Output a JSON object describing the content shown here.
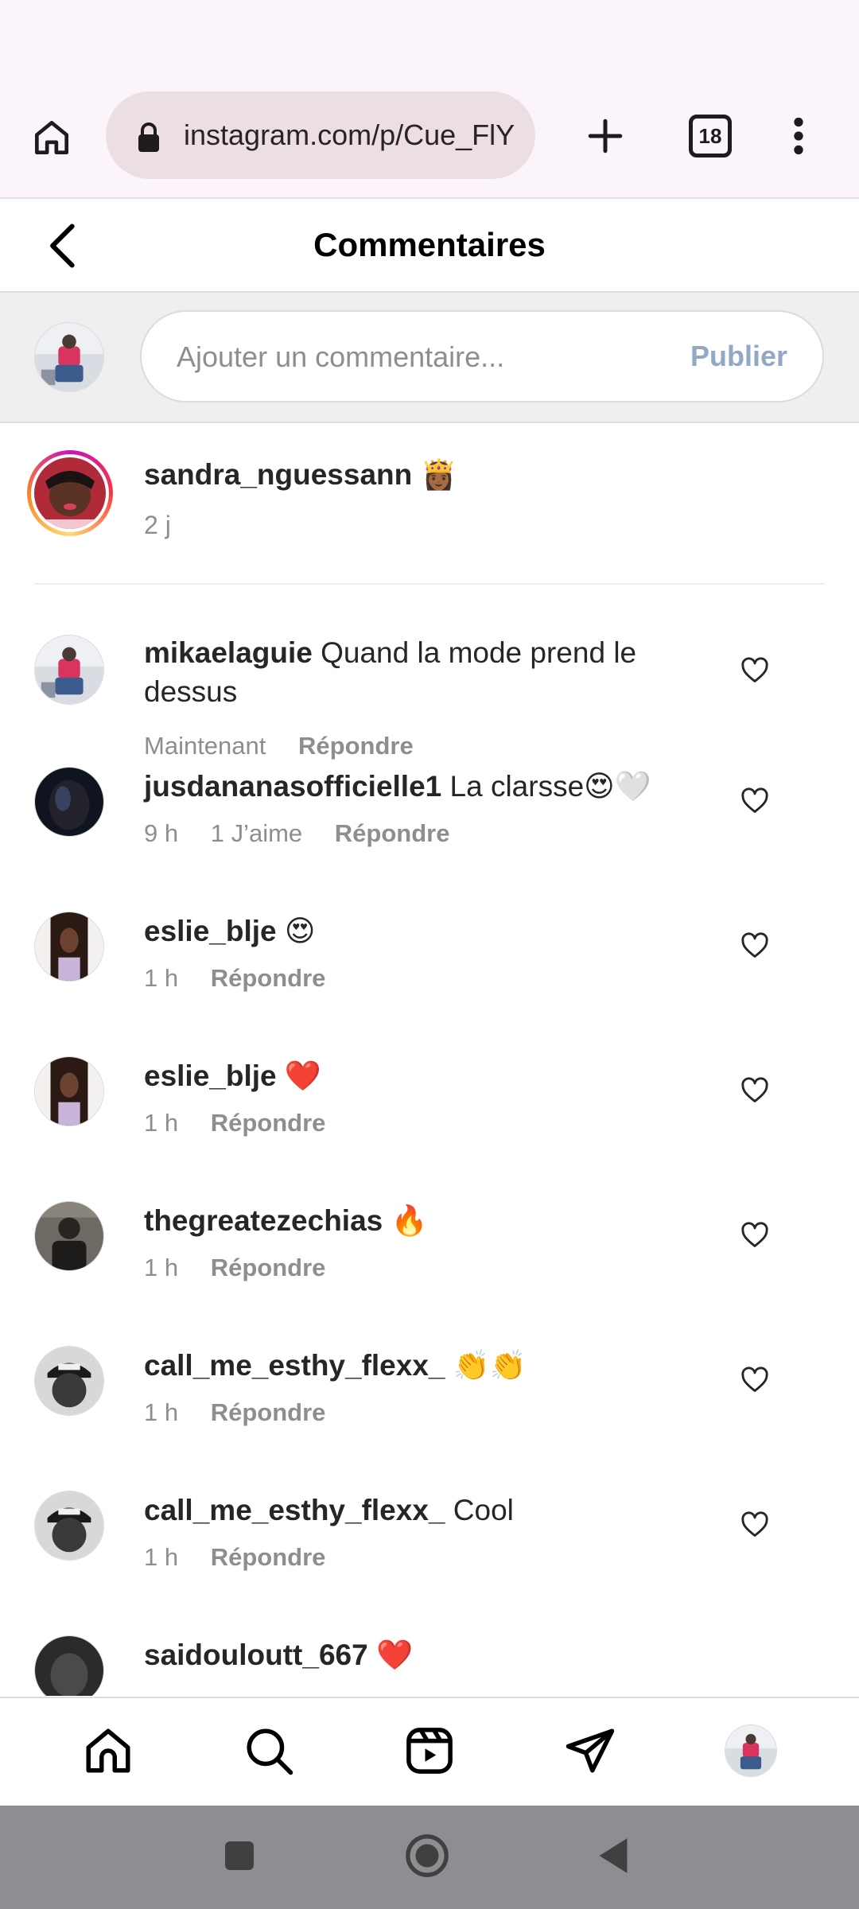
{
  "browser": {
    "url": "instagram.com/p/Cue_FlY",
    "tab_count": "18"
  },
  "header": {
    "title": "Commentaires"
  },
  "composer": {
    "placeholder": "Ajouter un commentaire...",
    "publish_label": "Publier"
  },
  "caption": {
    "username": "sandra_nguessann 👸🏾",
    "time": "2 j"
  },
  "comments": [
    {
      "username": "mikaelaguie",
      "text": "Quand la mode prend le dessus",
      "time": "Maintenant",
      "likes": "",
      "reply": "Répondre"
    },
    {
      "username": "jusdananasofficielle1",
      "text": "La clarsse😍🤍",
      "time": "9 h",
      "likes": "1 J’aime",
      "reply": "Répondre"
    },
    {
      "username": "eslie_blje",
      "text": "😍",
      "time": "1 h",
      "likes": "",
      "reply": "Répondre"
    },
    {
      "username": "eslie_blje",
      "text": "❤️",
      "time": "1 h",
      "likes": "",
      "reply": "Répondre"
    },
    {
      "username": "thegreatezechias",
      "text": "🔥",
      "time": "1 h",
      "likes": "",
      "reply": "Répondre"
    },
    {
      "username": "call_me_esthy_flexx_",
      "text": "👏👏",
      "time": "1 h",
      "likes": "",
      "reply": "Répondre"
    },
    {
      "username": "call_me_esthy_flexx_",
      "text": "Cool",
      "time": "1 h",
      "likes": "",
      "reply": "Répondre"
    },
    {
      "username": "saidouloutt_667",
      "text": "❤️",
      "time": "",
      "likes": "",
      "reply": ""
    }
  ],
  "icons": {
    "browser_home": "home-icon",
    "lock": "lock-icon",
    "new_tab": "plus-icon",
    "tabs": "tabs-icon",
    "menu": "more-vertical-icon",
    "back": "chevron-left-icon",
    "heart": "heart-outline-icon",
    "nav": [
      "home-icon",
      "search-icon",
      "reels-icon",
      "direct-message-icon",
      "profile-avatar"
    ]
  },
  "colors": {
    "publish_disabled": "#93a8c4",
    "secondary_text": "#8e8e8e",
    "browser_bg": "#fcf4fb"
  }
}
